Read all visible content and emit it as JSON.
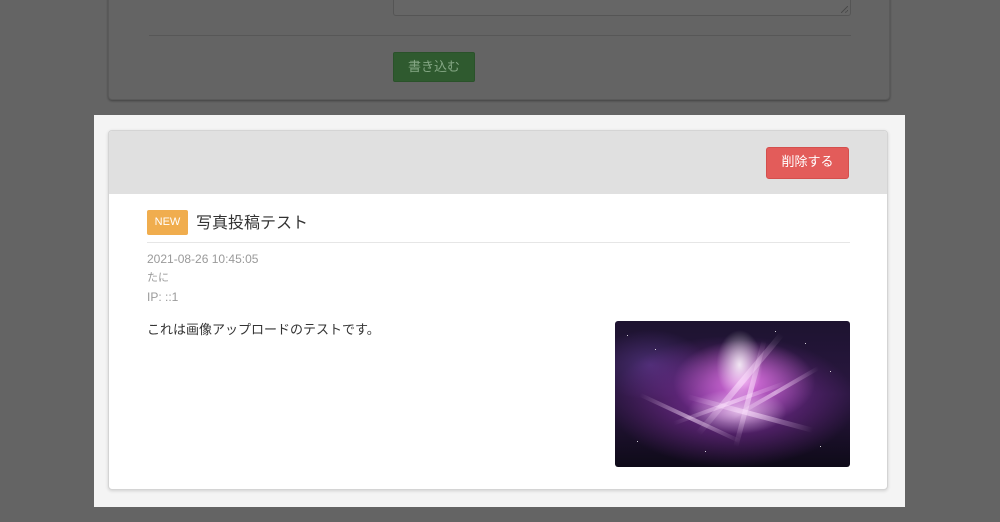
{
  "form": {
    "submit_label": "書き込む"
  },
  "post": {
    "delete_label": "削除する",
    "badge": "NEW",
    "title": "写真投稿テスト",
    "datetime": "2021-08-26 10:45:05",
    "author": "たに",
    "ip": "IP: ::1",
    "body": "これは画像アップロードのテストです。",
    "image_icon": "nebula-photo"
  },
  "colors": {
    "delete_button": "#e35c5a",
    "badge": "#f0ad4e",
    "submit_button": "#2f5a2f",
    "overlay": "#646464"
  }
}
